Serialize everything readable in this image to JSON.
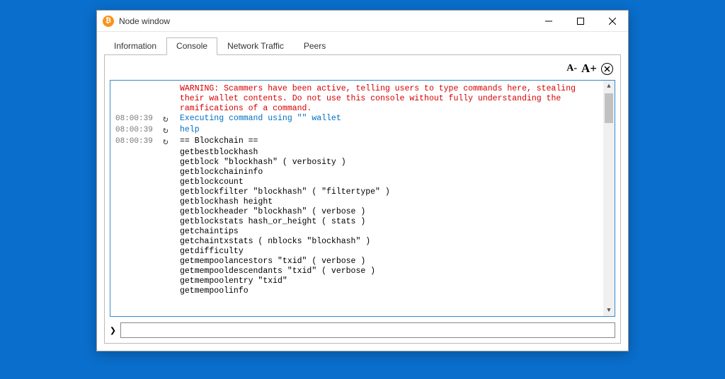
{
  "window": {
    "title": "Node window"
  },
  "tabs": {
    "information": "Information",
    "console": "Console",
    "network_traffic": "Network Traffic",
    "peers": "Peers"
  },
  "toolbar": {
    "font_minus": "A-",
    "font_plus": "A+"
  },
  "console": {
    "warning": "WARNING: Scammers have been active, telling users to type commands here, stealing their wallet contents. Do not use this console without fully understanding the ramifications of a command.",
    "rows": [
      {
        "ts": "08:00:39",
        "icon": "↻",
        "text": "Executing command using \"\" wallet",
        "cls": "blue"
      },
      {
        "ts": "08:00:39",
        "icon": "↻",
        "text": "help",
        "cls": "blue"
      },
      {
        "ts": "08:00:39",
        "icon": "↻",
        "text": "== Blockchain ==",
        "cls": ""
      }
    ],
    "help_commands": [
      "getbestblockhash",
      "getblock \"blockhash\" ( verbosity )",
      "getblockchaininfo",
      "getblockcount",
      "getblockfilter \"blockhash\" ( \"filtertype\" )",
      "getblockhash height",
      "getblockheader \"blockhash\" ( verbose )",
      "getblockstats hash_or_height ( stats )",
      "getchaintips",
      "getchaintxstats ( nblocks \"blockhash\" )",
      "getdifficulty",
      "getmempoolancestors \"txid\" ( verbose )",
      "getmempooldescendants \"txid\" ( verbose )",
      "getmempoolentry \"txid\"",
      "getmempoolinfo"
    ]
  },
  "input": {
    "prompt": "❯",
    "value": ""
  }
}
